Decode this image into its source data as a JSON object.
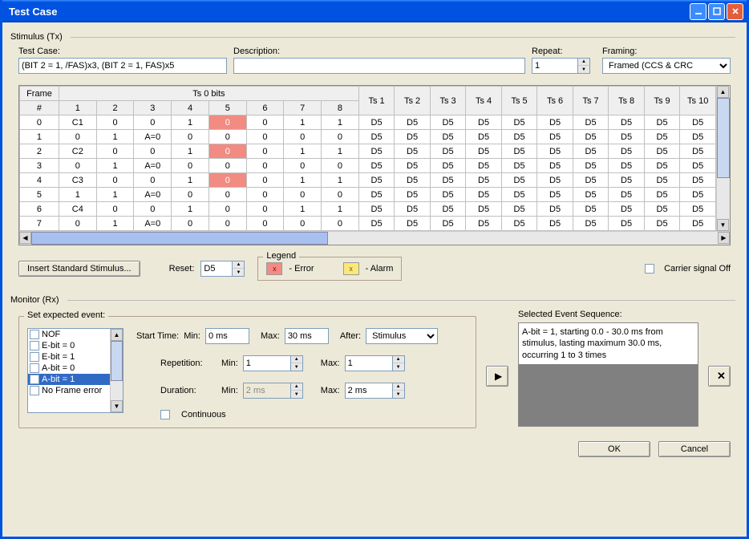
{
  "window": {
    "title": "Test Case"
  },
  "stimulus": {
    "label": "Stimulus (Tx)",
    "testcase_label": "Test Case:",
    "testcase_value": "(BIT 2 = 1, /FAS)x3, (BIT 2 = 1, FAS)x5",
    "description_label": "Description:",
    "description_value": "",
    "repeat_label": "Repeat:",
    "repeat_value": "1",
    "framing_label": "Framing:",
    "framing_value": "Framed (CCS & CRC"
  },
  "grid": {
    "h1": [
      "Frame",
      "Ts 0 bits",
      "",
      "",
      "",
      "",
      "",
      "",
      "",
      "Ts 1",
      "Ts 2",
      "Ts 3",
      "Ts 4",
      "Ts 5",
      "Ts 6",
      "Ts 7",
      "Ts 8",
      "Ts 9",
      "Ts 10"
    ],
    "h2": [
      "#",
      "1",
      "2",
      "3",
      "4",
      "5",
      "6",
      "7",
      "8",
      "",
      "",
      "",
      "",
      "",
      "",
      "",
      "",
      "",
      ""
    ],
    "rows": [
      [
        "0",
        "C1",
        "0",
        "0",
        "1",
        "0",
        "0",
        "1",
        "1",
        "D5",
        "D5",
        "D5",
        "D5",
        "D5",
        "D5",
        "D5",
        "D5",
        "D5",
        "D5"
      ],
      [
        "1",
        "0",
        "1",
        "A=0",
        "0",
        "0",
        "0",
        "0",
        "0",
        "D5",
        "D5",
        "D5",
        "D5",
        "D5",
        "D5",
        "D5",
        "D5",
        "D5",
        "D5"
      ],
      [
        "2",
        "C2",
        "0",
        "0",
        "1",
        "0",
        "0",
        "1",
        "1",
        "D5",
        "D5",
        "D5",
        "D5",
        "D5",
        "D5",
        "D5",
        "D5",
        "D5",
        "D5"
      ],
      [
        "3",
        "0",
        "1",
        "A=0",
        "0",
        "0",
        "0",
        "0",
        "0",
        "D5",
        "D5",
        "D5",
        "D5",
        "D5",
        "D5",
        "D5",
        "D5",
        "D5",
        "D5"
      ],
      [
        "4",
        "C3",
        "0",
        "0",
        "1",
        "0",
        "0",
        "1",
        "1",
        "D5",
        "D5",
        "D5",
        "D5",
        "D5",
        "D5",
        "D5",
        "D5",
        "D5",
        "D5"
      ],
      [
        "5",
        "1",
        "1",
        "A=0",
        "0",
        "0",
        "0",
        "0",
        "0",
        "D5",
        "D5",
        "D5",
        "D5",
        "D5",
        "D5",
        "D5",
        "D5",
        "D5",
        "D5"
      ],
      [
        "6",
        "C4",
        "0",
        "0",
        "1",
        "0",
        "0",
        "1",
        "1",
        "D5",
        "D5",
        "D5",
        "D5",
        "D5",
        "D5",
        "D5",
        "D5",
        "D5",
        "D5"
      ],
      [
        "7",
        "0",
        "1",
        "A=0",
        "0",
        "0",
        "0",
        "0",
        "0",
        "D5",
        "D5",
        "D5",
        "D5",
        "D5",
        "D5",
        "D5",
        "D5",
        "D5",
        "D5"
      ]
    ],
    "error_cells": [
      [
        0,
        5
      ],
      [
        2,
        5
      ],
      [
        4,
        5
      ]
    ]
  },
  "toolbar": {
    "insert_stimulus": "Insert Standard Stimulus...",
    "reset_label": "Reset:",
    "reset_value": "D5",
    "legend_label": "Legend",
    "legend_error": "- Error",
    "legend_alarm": "- Alarm",
    "carrier_off": "Carrier signal Off"
  },
  "monitor": {
    "label": "Monitor (Rx)",
    "set_event_label": "Set expected event:",
    "events": [
      "NOF",
      "E-bit = 0",
      "E-bit = 1",
      "A-bit = 0",
      "A-bit = 1",
      "No Frame error"
    ],
    "event_selected": 4,
    "event_checked": [
      4
    ],
    "start_time_label": "Start Time:",
    "min_label": "Min:",
    "max_label": "Max:",
    "start_min": "0 ms",
    "start_max": "30 ms",
    "after_label": "After:",
    "after_value": "Stimulus",
    "repetition_label": "Repetition:",
    "rep_min": "1",
    "rep_max": "1",
    "duration_label": "Duration:",
    "dur_min": "2 ms",
    "dur_max": "2 ms",
    "continuous_label": "Continuous",
    "selected_seq_label": "Selected Event Sequence:",
    "selected_seq_text": "A-bit = 1, starting 0.0 - 30.0 ms from stimulus, lasting maximum 30.0 ms, occurring 1 to 3 times"
  },
  "buttons": {
    "ok": "OK",
    "cancel": "Cancel"
  },
  "icons": {
    "x": "x"
  }
}
